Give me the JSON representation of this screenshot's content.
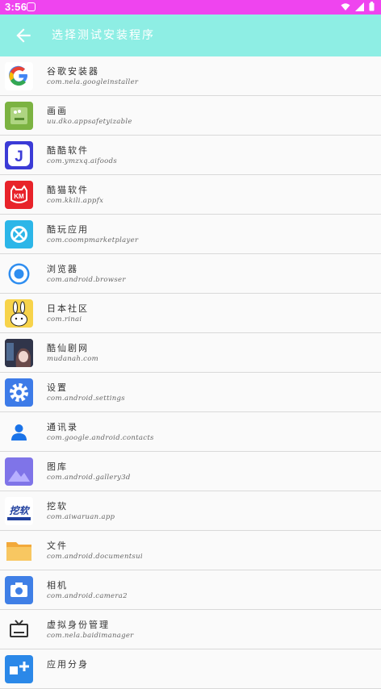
{
  "status": {
    "time": "3:56"
  },
  "appbar": {
    "title": "选择测试安装程序"
  },
  "apps": [
    {
      "name": "谷歌安装器",
      "pkg": "com.nela.googleinstaller",
      "icon": "google-icon"
    },
    {
      "name": "画画",
      "pkg": "uu.dko.appsafetyizable",
      "icon": "paint-icon"
    },
    {
      "name": "酷酷软件",
      "pkg": "com.ymzxq.aifoods",
      "icon": "j-letter-icon"
    },
    {
      "name": "酷猫软件",
      "pkg": "com.kkili.appfx",
      "icon": "km-cat-icon"
    },
    {
      "name": "酷玩应用",
      "pkg": "com.coompmarketplayer",
      "icon": "game-controller-icon"
    },
    {
      "name": "浏览器",
      "pkg": "com.android.browser",
      "icon": "browser-icon"
    },
    {
      "name": "日本社区",
      "pkg": "com.rinai",
      "icon": "bunny-icon"
    },
    {
      "name": "酷仙剧网",
      "pkg": "mudanah.com",
      "icon": "anime-girl-icon"
    },
    {
      "name": "设置",
      "pkg": "com.android.settings",
      "icon": "gear-icon"
    },
    {
      "name": "通讯录",
      "pkg": "com.google.android.contacts",
      "icon": "contacts-icon"
    },
    {
      "name": "图库",
      "pkg": "com.android.gallery3d",
      "icon": "gallery-icon"
    },
    {
      "name": "挖软",
      "pkg": "com.aiwaruan.app",
      "icon": "waruan-logo-icon"
    },
    {
      "name": "文件",
      "pkg": "com.android.documentsui",
      "icon": "folder-icon"
    },
    {
      "name": "相机",
      "pkg": "com.android.camera2",
      "icon": "camera-icon"
    },
    {
      "name": "虚拟身份管理",
      "pkg": "com.nela.baidimanager",
      "icon": "tv-icon"
    },
    {
      "name": "应用分身",
      "pkg": "",
      "icon": "app-clone-icon"
    }
  ]
}
